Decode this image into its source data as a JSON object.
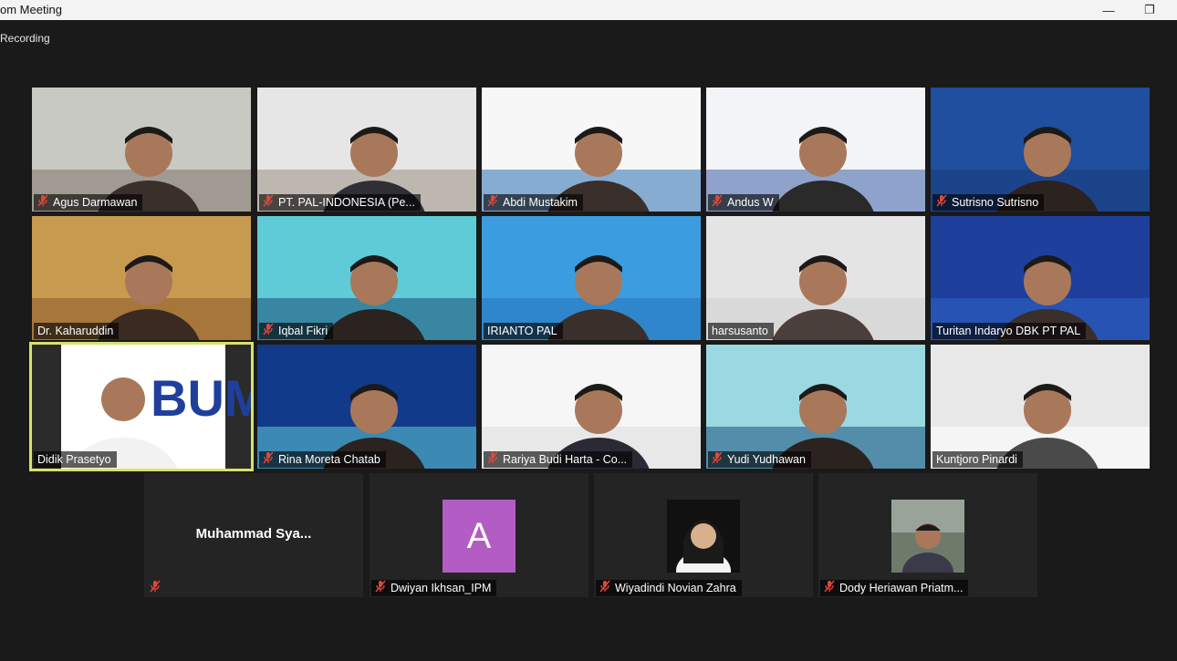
{
  "window": {
    "title": "om Meeting",
    "minimize_icon": "minimize-icon",
    "restore_icon": "restore-icon"
  },
  "recording": "Recording",
  "participants": [
    {
      "name": "Agus Darmawan",
      "muted": true
    },
    {
      "name": "PT. PAL-INDONESIA (Pe...",
      "muted": true
    },
    {
      "name": "Abdi Mustakim",
      "muted": true
    },
    {
      "name": "Andus W",
      "muted": true
    },
    {
      "name": "Sutrisno Sutrisno",
      "muted": true
    },
    {
      "name": "Dr. Kaharuddin",
      "muted": false
    },
    {
      "name": "Iqbal Fikri",
      "muted": true
    },
    {
      "name": "IRIANTO PAL",
      "muted": false
    },
    {
      "name": "harsusanto",
      "muted": false
    },
    {
      "name": "Turitan Indaryo DBK PT PAL",
      "muted": false
    },
    {
      "name": "Didik Prasetyo",
      "muted": false,
      "active_speaker": true
    },
    {
      "name": "Rina Moreta Chatab",
      "muted": true
    },
    {
      "name": "Rariya Budi Harta - Co...",
      "muted": true
    },
    {
      "name": "Yudi Yudhawan",
      "muted": true
    },
    {
      "name": "Kuntjoro Pinardi",
      "muted": false
    }
  ],
  "bottom_row": [
    {
      "name": "Muhammad Sya...",
      "label": "",
      "muted": true,
      "type": "name-only"
    },
    {
      "name": "Dwiyan Ikhsan_IPM",
      "muted": true,
      "type": "avatar",
      "avatar_letter": "A",
      "avatar_color": "#b35cc4"
    },
    {
      "name": "Wiyadindi Novian Zahra",
      "muted": true,
      "type": "photo"
    },
    {
      "name": "Dody Heriawan Priatm...",
      "muted": true,
      "type": "photo"
    }
  ],
  "colors": {
    "background": "#1a1a1a",
    "active_speaker_border": "#d8e26a",
    "muted_icon": "#e0473a"
  }
}
